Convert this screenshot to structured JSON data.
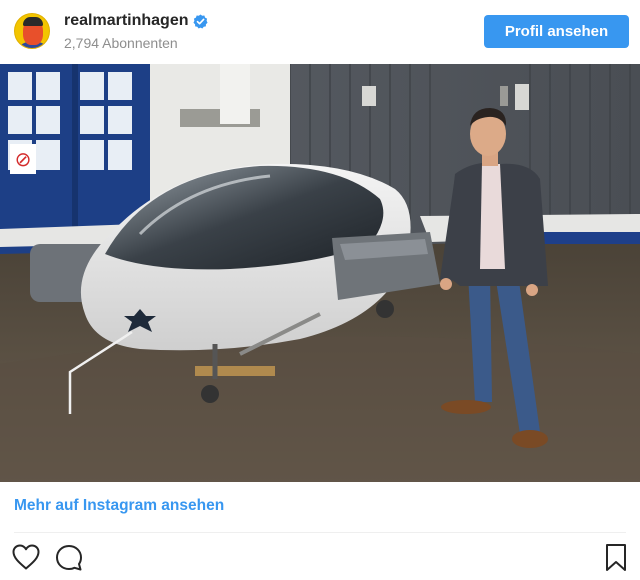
{
  "header": {
    "username": "realmartinhagen",
    "followers": "2,794 Abonnenten",
    "profile_button": "Profil ansehen",
    "avatar_icon": "avatar-portrait",
    "verified_icon": "verified-badge-icon"
  },
  "photo": {
    "sign_text": "⊘"
  },
  "footer": {
    "more_link": "Mehr auf Instagram ansehen"
  },
  "actions": [
    {
      "icon": "heart-icon"
    },
    {
      "icon": "comment-icon"
    },
    {
      "icon": "bookmark-icon"
    }
  ],
  "colors": {
    "accent": "#3897f0",
    "text": "#262626",
    "muted": "#8e8e8e",
    "divider": "#efefef"
  }
}
